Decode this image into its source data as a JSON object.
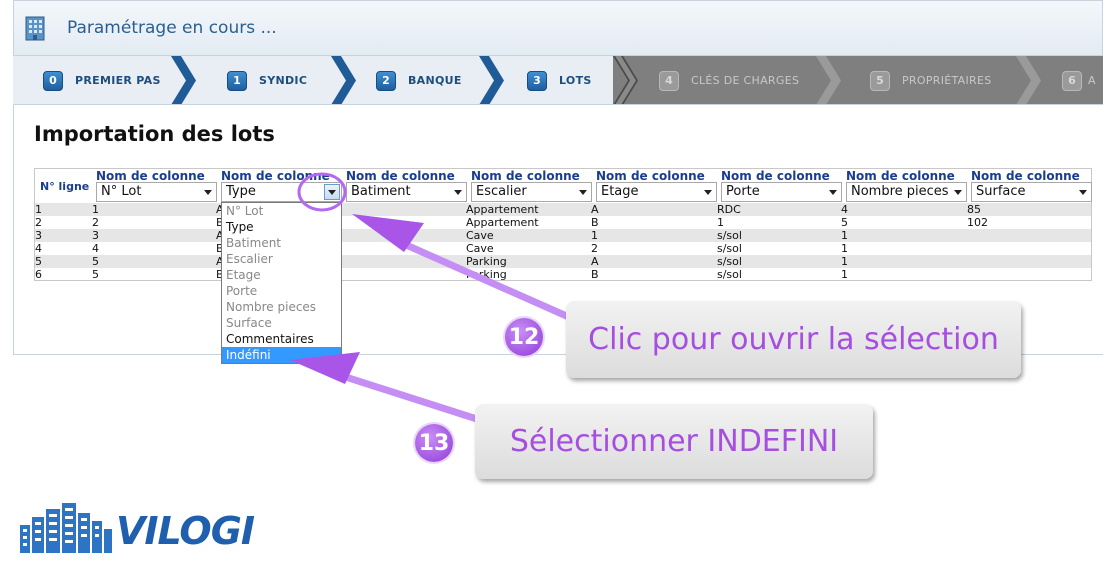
{
  "header": {
    "title": "Paramétrage en cours ..."
  },
  "steps": [
    {
      "num": "0",
      "label": "PREMIER PAS",
      "enabled": true
    },
    {
      "num": "1",
      "label": "SYNDIC",
      "enabled": true
    },
    {
      "num": "2",
      "label": "BANQUE",
      "enabled": true
    },
    {
      "num": "3",
      "label": "LOTS",
      "enabled": true
    },
    {
      "num": "4",
      "label": "CLÉS DE CHARGES",
      "enabled": false
    },
    {
      "num": "5",
      "label": "PROPRIÉTAIRES",
      "enabled": false
    },
    {
      "num": "6",
      "label": "A",
      "enabled": false
    }
  ],
  "page_title": "Importation des lots",
  "grid": {
    "row_header": "N° ligne",
    "column_header": "Nom de colonne",
    "selects": [
      "N° Lot",
      "Type",
      "Batiment",
      "Escalier",
      "Etage",
      "Porte",
      "Nombre pieces",
      "Surface"
    ],
    "rows": [
      [
        "1",
        "1",
        "A",
        "",
        "Appartement",
        "A",
        "RDC",
        "4",
        "85"
      ],
      [
        "2",
        "2",
        "B",
        "",
        "Appartement",
        "B",
        "1",
        "5",
        "102"
      ],
      [
        "3",
        "3",
        "A",
        "",
        "Cave",
        "1",
        "s/sol",
        "1",
        ""
      ],
      [
        "4",
        "4",
        "B",
        "",
        "Cave",
        "2",
        "s/sol",
        "1",
        ""
      ],
      [
        "5",
        "5",
        "A",
        "",
        "Parking",
        "A",
        "s/sol",
        "1",
        ""
      ],
      [
        "6",
        "5",
        "B",
        "",
        "Parking",
        "B",
        "s/sol",
        "1",
        ""
      ]
    ]
  },
  "dropdown": {
    "options": [
      {
        "label": "N° Lot",
        "state": "disabled"
      },
      {
        "label": "Type",
        "state": "enabled"
      },
      {
        "label": "Batiment",
        "state": "disabled"
      },
      {
        "label": "Escalier",
        "state": "disabled"
      },
      {
        "label": "Etage",
        "state": "disabled"
      },
      {
        "label": "Porte",
        "state": "disabled"
      },
      {
        "label": "Nombre pieces",
        "state": "disabled"
      },
      {
        "label": "Surface",
        "state": "disabled"
      },
      {
        "label": "Commentaires",
        "state": "enabled"
      },
      {
        "label": "Indéfini",
        "state": "selected"
      }
    ]
  },
  "annotations": {
    "step12": {
      "number": "12",
      "text": "Clic pour ouvrir la sélection"
    },
    "step13": {
      "number": "13",
      "text": "Sélectionner INDEFINI"
    }
  },
  "logo": {
    "text": "VILOGI"
  },
  "colors": {
    "brand_blue": "#1d5f9f",
    "annotation_purple": "#a64ee0",
    "highlight": "#3399ff"
  }
}
